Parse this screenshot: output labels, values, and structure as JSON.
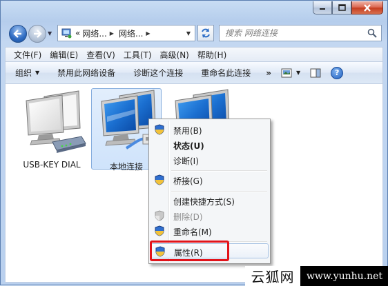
{
  "window": {
    "caption_buttons": [
      "minimize",
      "maximize",
      "close"
    ]
  },
  "nav": {
    "back_icon": "back-arrow-icon",
    "forward_icon": "forward-arrow-icon"
  },
  "address": {
    "prefix": "«",
    "crumbs": [
      "网络...",
      "网络..."
    ]
  },
  "search": {
    "placeholder": "搜索 网络连接"
  },
  "menubar": {
    "items": [
      "文件(F)",
      "编辑(E)",
      "查看(V)",
      "工具(T)",
      "高级(N)",
      "帮助(H)"
    ]
  },
  "cmdbar": {
    "organize": "组织",
    "disable": "禁用此网络设备",
    "diagnose": "诊断这个连接",
    "rename": "重命名此连接",
    "more": "»"
  },
  "connections": [
    {
      "label": "USB-KEY DIAL",
      "selected": false
    },
    {
      "label": "本地连接",
      "selected": true
    },
    {
      "label": "",
      "selected": false
    }
  ],
  "context_menu": {
    "items": [
      {
        "label": "禁用(B)",
        "shield": true,
        "bold": false,
        "disabled": false
      },
      {
        "label": "状态(U)",
        "shield": false,
        "bold": true,
        "disabled": false
      },
      {
        "label": "诊断(I)",
        "shield": false,
        "bold": false,
        "disabled": false
      },
      {
        "label": "桥接(G)",
        "shield": true,
        "bold": false,
        "disabled": false
      },
      {
        "label": "创建快捷方式(S)",
        "shield": false,
        "bold": false,
        "disabled": false
      },
      {
        "label": "删除(D)",
        "shield": true,
        "bold": false,
        "disabled": true
      },
      {
        "label": "重命名(M)",
        "shield": true,
        "bold": false,
        "disabled": false
      },
      {
        "label": "属性(R)",
        "shield": true,
        "bold": false,
        "disabled": false
      }
    ]
  },
  "colors": {
    "highlight": "#e2131a",
    "selection": "#cfe3fb"
  },
  "watermark": {
    "cn": "云狐网",
    "url": "www.yunhu.net"
  }
}
